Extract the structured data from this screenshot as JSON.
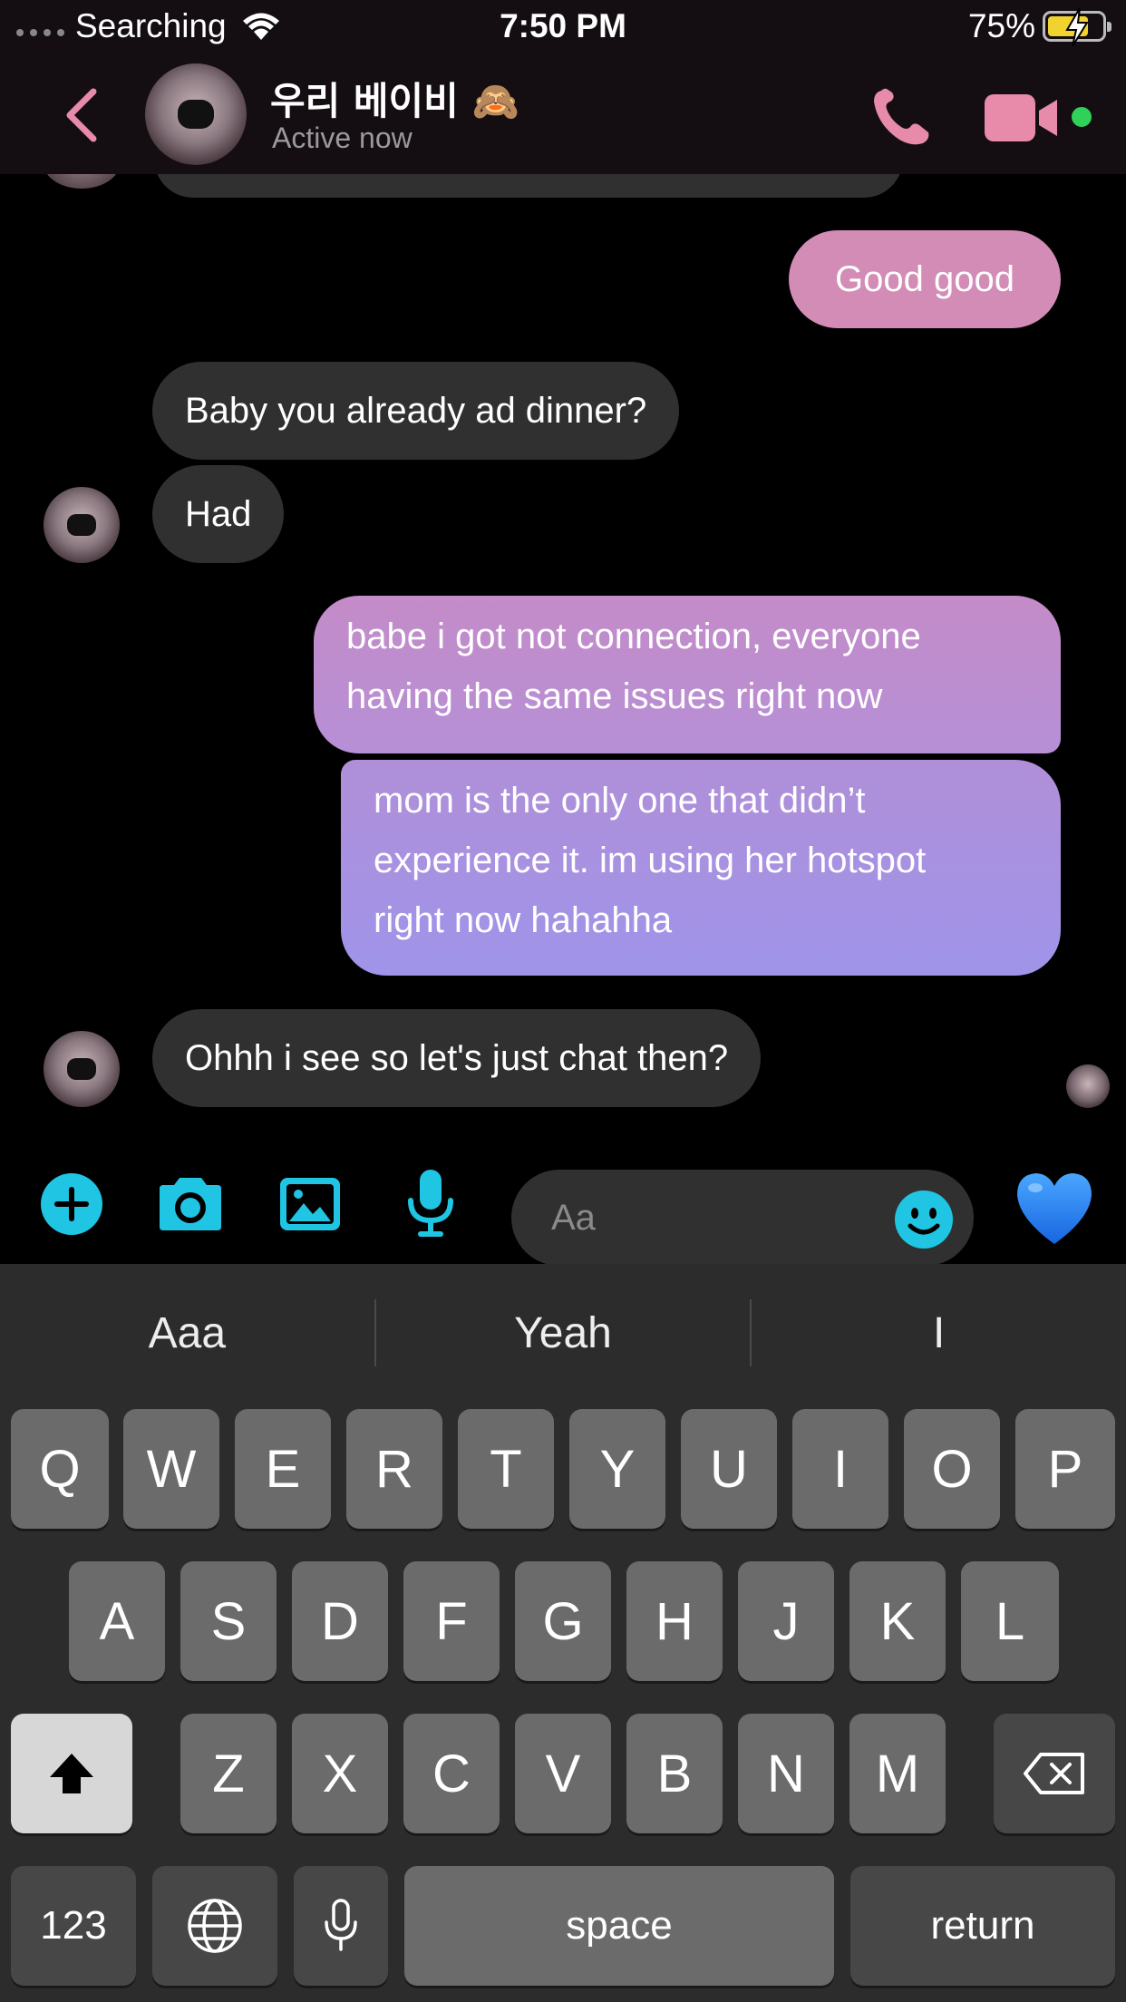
{
  "status_bar": {
    "carrier": "Searching",
    "time": "7:50 PM",
    "battery_percent": "75%",
    "battery_level": 0.75,
    "charging": true
  },
  "header": {
    "contact_name": "우리 베이비 🙈",
    "contact_status": "Active now",
    "accent_color": "#e88aaa",
    "active_color": "#30d158"
  },
  "messages": [
    {
      "direction": "outgoing",
      "text": "Good good"
    },
    {
      "direction": "incoming",
      "text": "Baby you already ad dinner?"
    },
    {
      "direction": "incoming",
      "text": "Had"
    },
    {
      "direction": "outgoing",
      "lines": [
        "babe i got not connection, everyone",
        "having the same issues right now"
      ]
    },
    {
      "direction": "outgoing",
      "lines": [
        "mom is the only one that didn’t",
        "experience it. im using her hotspot",
        "right now hahahha"
      ]
    },
    {
      "direction": "incoming",
      "text": "Ohhh i see so let's just chat then?"
    }
  ],
  "composer": {
    "placeholder": "Aa",
    "accent_color": "#1fc5e3",
    "like_emoji": "💙"
  },
  "keyboard": {
    "predictions": [
      "Aaa",
      "Yeah",
      "I"
    ],
    "row1": [
      "Q",
      "W",
      "E",
      "R",
      "T",
      "Y",
      "U",
      "I",
      "O",
      "P"
    ],
    "row2": [
      "A",
      "S",
      "D",
      "F",
      "G",
      "H",
      "J",
      "K",
      "L"
    ],
    "row3": [
      "Z",
      "X",
      "C",
      "V",
      "B",
      "N",
      "M"
    ],
    "numbers_label": "123",
    "space_label": "space",
    "return_label": "return"
  }
}
